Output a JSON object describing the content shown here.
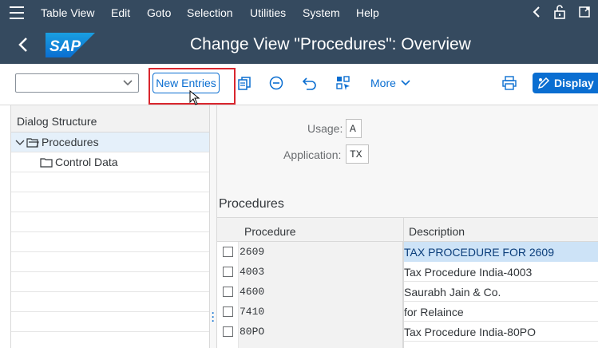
{
  "menu": {
    "items": [
      "Table View",
      "Edit",
      "Goto",
      "Selection",
      "Utilities",
      "System",
      "Help"
    ]
  },
  "header": {
    "logo_text": "SAP",
    "title": "Change View \"Procedures\": Overview"
  },
  "toolbar": {
    "new_entries_label": "New Entries",
    "more_label": "More",
    "display_label": "Display"
  },
  "dialog_structure": {
    "title": "Dialog Structure",
    "items": [
      {
        "label": "Procedures",
        "selected": true
      },
      {
        "label": "Control Data",
        "selected": false
      }
    ]
  },
  "fields": {
    "usage_label": "Usage:",
    "usage_value": "A",
    "application_label": "Application:",
    "application_value": "TX"
  },
  "procedures": {
    "title": "Procedures",
    "columns": [
      "Procedure",
      "Description"
    ],
    "rows": [
      {
        "procedure": "2609",
        "description": "TAX PROCEDURE FOR 2609"
      },
      {
        "procedure": "4003",
        "description": "Tax Procedure India-4003"
      },
      {
        "procedure": "4600",
        "description": "Saurabh Jain & Co."
      },
      {
        "procedure": "7410",
        "description": "for Relaince"
      },
      {
        "procedure": "80PO",
        "description": "Tax Procedure India-80PO"
      }
    ]
  },
  "colors": {
    "shell": "#354a5f",
    "accent": "#0a6ed1",
    "highlight_frame": "#d9262e"
  }
}
